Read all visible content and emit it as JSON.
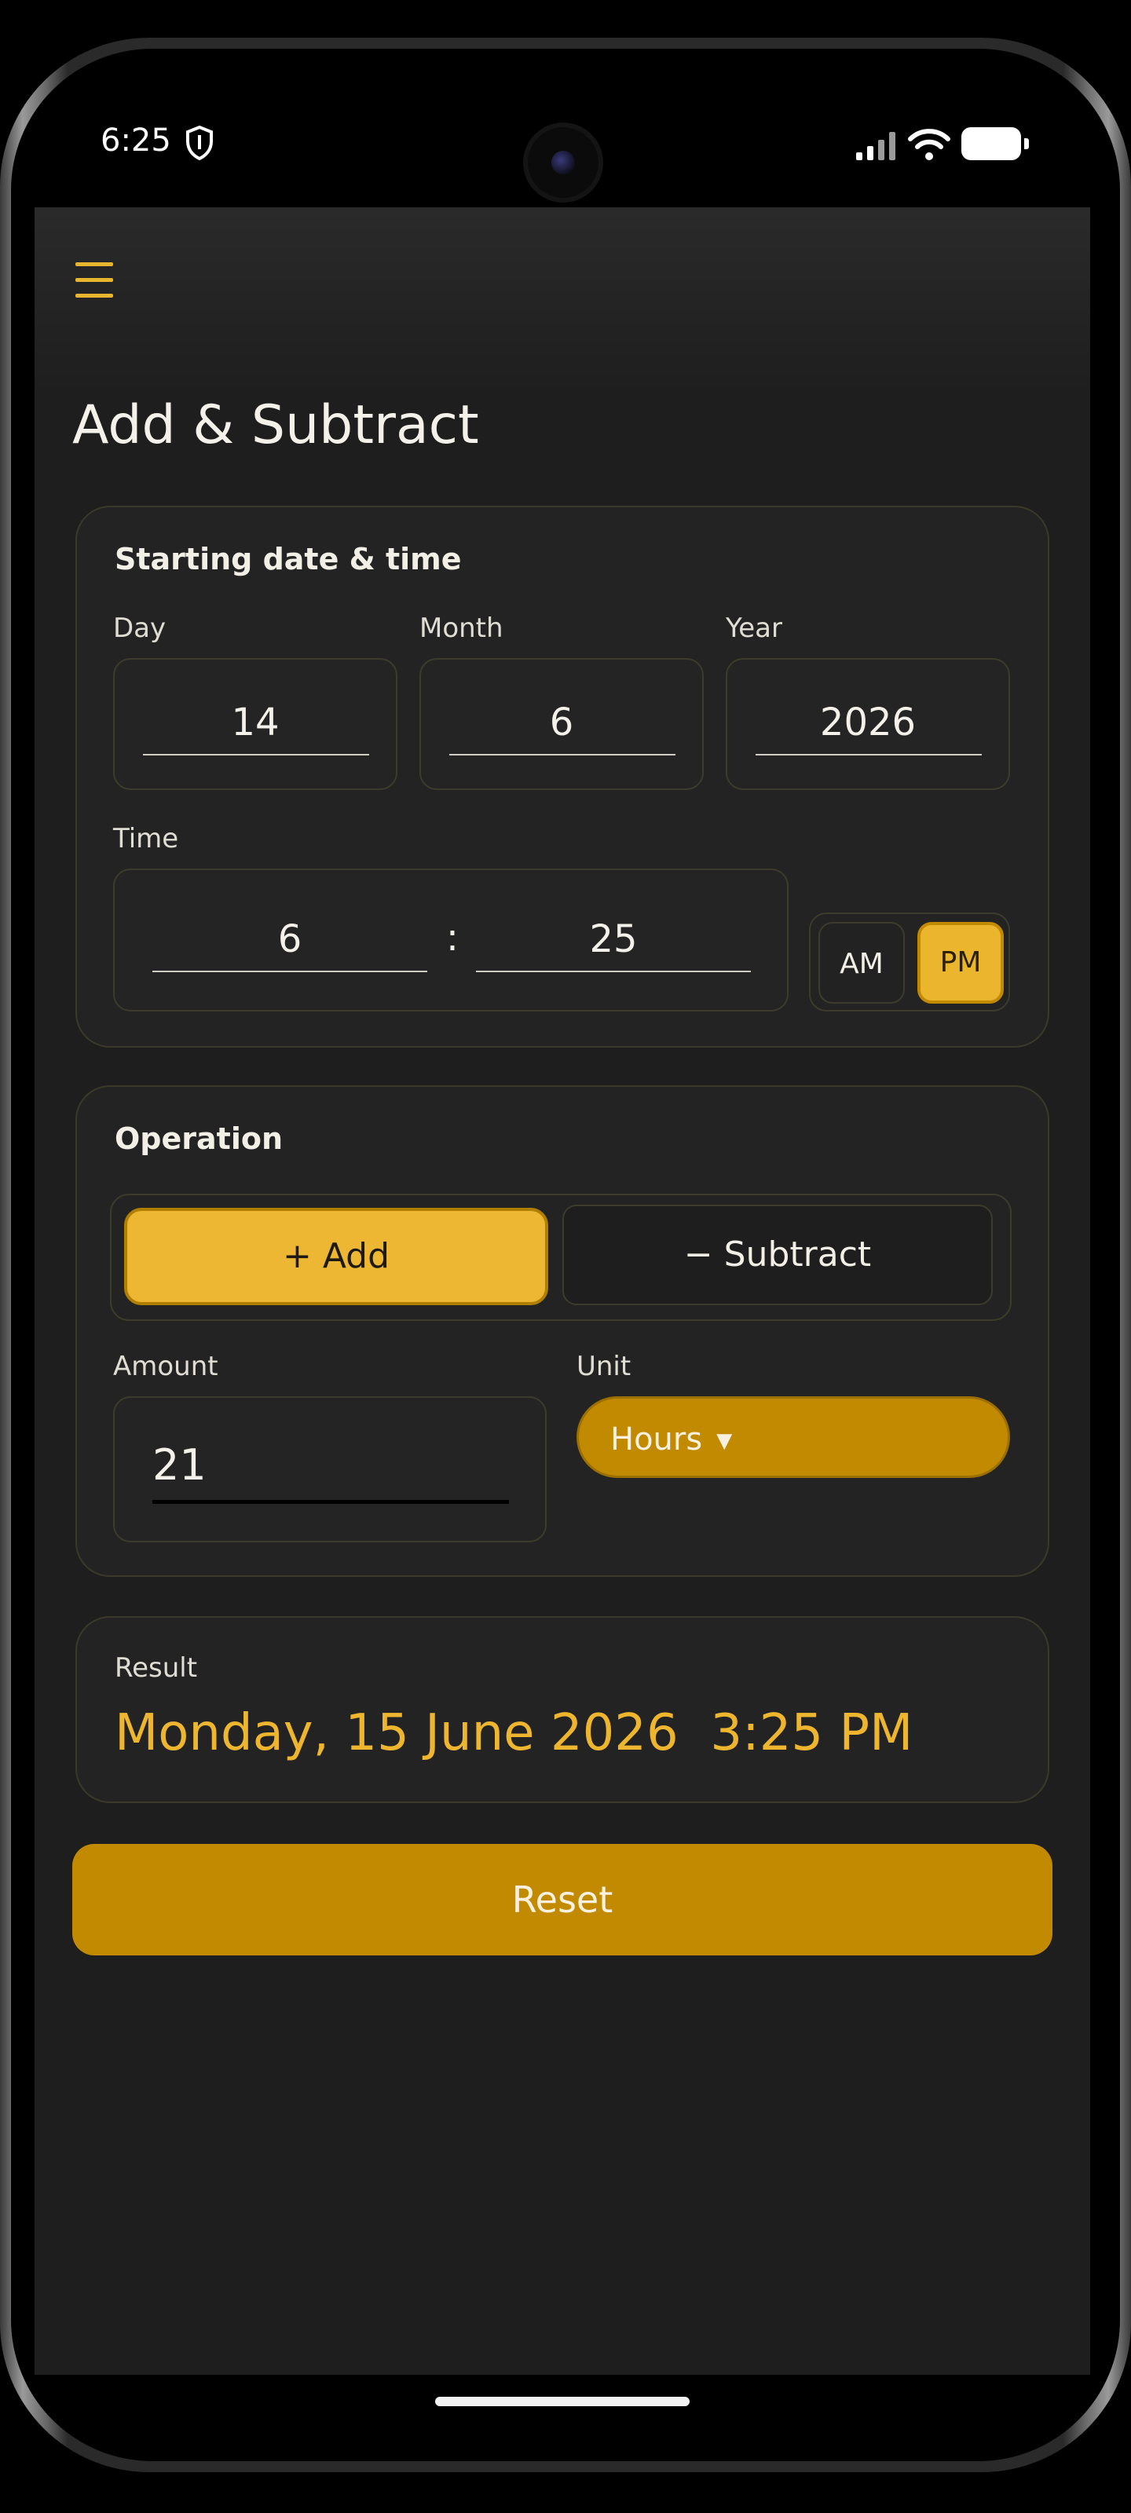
{
  "status": {
    "time": "6:25",
    "shield_icon": "shield-icon",
    "signal_icon": "signal-icon",
    "wifi_icon": "wifi-icon",
    "battery_icon": "battery-icon"
  },
  "header": {
    "menu_icon": "hamburger-menu-icon"
  },
  "page": {
    "title": "Add & Subtract"
  },
  "start": {
    "title": "Starting date & time",
    "day_label": "Day",
    "month_label": "Month",
    "year_label": "Year",
    "day": "14",
    "month": "6",
    "year": "2026",
    "time_label": "Time",
    "hour": "6",
    "separator": ":",
    "minute": "25",
    "am_label": "AM",
    "pm_label": "PM",
    "selected_period": "PM"
  },
  "operation": {
    "title": "Operation",
    "add_label": "+  Add",
    "subtract_label": "−  Subtract",
    "selected": "Add",
    "amount_label": "Amount",
    "amount": "21",
    "unit_label": "Unit",
    "unit": "Hours",
    "unit_arrow": "▼"
  },
  "result": {
    "label": "Result",
    "value": "Monday, 15 June 2026  3:25 PM"
  },
  "actions": {
    "reset_label": "Reset"
  },
  "colors": {
    "accent": "#edb734",
    "accent_dark": "#c28a00",
    "background": "#1e1e1e",
    "card": "#232323"
  }
}
